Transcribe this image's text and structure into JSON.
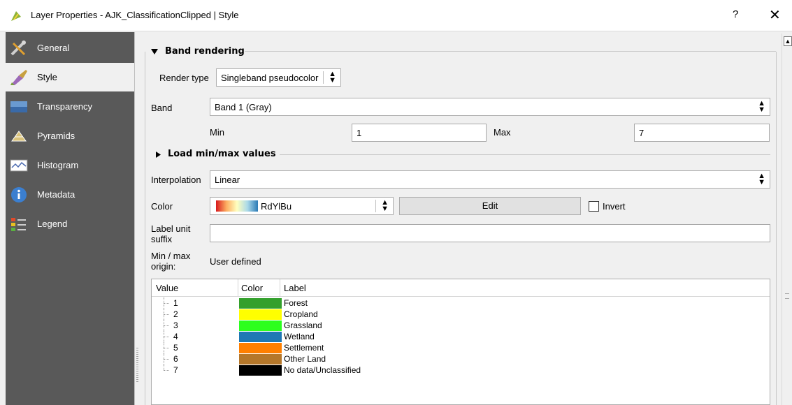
{
  "window": {
    "title": "Layer Properties - AJK_ClassificationClipped | Style",
    "help": "?",
    "close": "✕"
  },
  "sidebar": {
    "items": [
      {
        "label": "General",
        "icon": "general-tools-icon"
      },
      {
        "label": "Style",
        "icon": "style-brush-icon",
        "active": true
      },
      {
        "label": "Transparency",
        "icon": "transparency-icon"
      },
      {
        "label": "Pyramids",
        "icon": "pyramids-icon"
      },
      {
        "label": "Histogram",
        "icon": "histogram-icon"
      },
      {
        "label": "Metadata",
        "icon": "metadata-info-icon"
      },
      {
        "label": "Legend",
        "icon": "legend-icon"
      }
    ]
  },
  "band_rendering": {
    "section_title": "Band rendering",
    "render_type_label": "Render type",
    "render_type_value": "Singleband pseudocolor",
    "band_label": "Band",
    "band_value": "Band 1 (Gray)",
    "min_label": "Min",
    "min_value": "1",
    "max_label": "Max",
    "max_value": "7",
    "load_minmax_title": "Load min/max values",
    "interpolation_label": "Interpolation",
    "interpolation_value": "Linear",
    "color_label": "Color",
    "color_ramp_name": "RdYlBu",
    "edit_button": "Edit",
    "invert_label": "Invert",
    "invert_checked": false,
    "label_unit_suffix_label_1": "Label unit",
    "label_unit_suffix_label_2": "suffix",
    "label_unit_suffix_value": "",
    "minmax_origin_label_1": "Min / max",
    "minmax_origin_label_2": "origin:",
    "minmax_origin_value": "User defined"
  },
  "classes": {
    "headers": {
      "value": "Value",
      "color": "Color",
      "label": "Label"
    },
    "rows": [
      {
        "value": "1",
        "color": "#33a02c",
        "label": "Forest"
      },
      {
        "value": "2",
        "color": "#ffff00",
        "label": "Cropland"
      },
      {
        "value": "3",
        "color": "#2cff1e",
        "label": "Grassland"
      },
      {
        "value": "4",
        "color": "#1f78b4",
        "label": "Wetland"
      },
      {
        "value": "5",
        "color": "#ff7f00",
        "label": "Settlement"
      },
      {
        "value": "6",
        "color": "#b5772a",
        "label": "Other Land"
      },
      {
        "value": "7",
        "color": "#000000",
        "label": "No data/Unclassified"
      }
    ]
  }
}
